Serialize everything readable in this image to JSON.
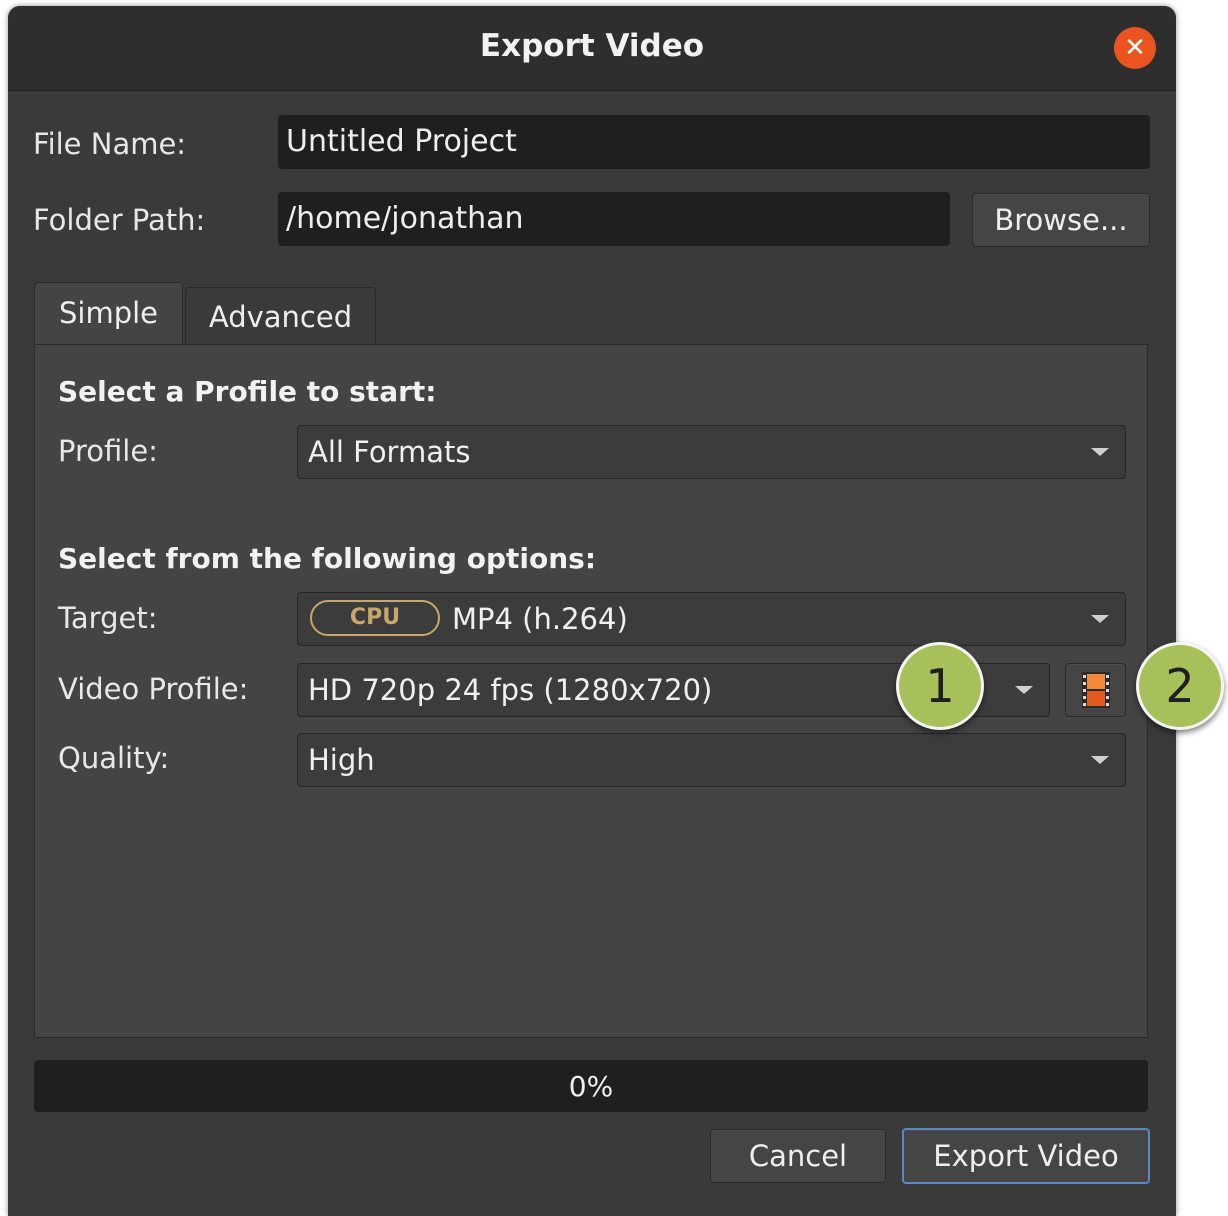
{
  "window": {
    "title": "Export Video",
    "close_icon": "close-icon"
  },
  "file_name": {
    "label": "File Name:",
    "value": "Untitled Project"
  },
  "folder_path": {
    "label": "Folder Path:",
    "value": "/home/jonathan",
    "browse_label": "Browse..."
  },
  "tabs": [
    {
      "label": "Simple",
      "active": true
    },
    {
      "label": "Advanced",
      "active": false
    }
  ],
  "simple": {
    "profile_heading": "Select a Profile to start:",
    "profile_label": "Profile:",
    "profile_value": "All Formats",
    "options_heading": "Select from the following options:",
    "target_label": "Target:",
    "target_badge": "CPU",
    "target_value": "MP4 (h.264)",
    "video_profile_label": "Video Profile:",
    "video_profile_value": "HD 720p 24 fps (1280x720)",
    "video_profile_button_icon": "film-strip-icon",
    "quality_label": "Quality:",
    "quality_value": "High"
  },
  "markers": [
    "1",
    "2"
  ],
  "progress": {
    "text": "0%",
    "value": 0
  },
  "footer": {
    "cancel_label": "Cancel",
    "export_label": "Export Video"
  },
  "colors": {
    "accent": "#e95420",
    "marker": "#a8c05a",
    "badge": "#c8a86a",
    "focus_border": "#5b87c4"
  }
}
